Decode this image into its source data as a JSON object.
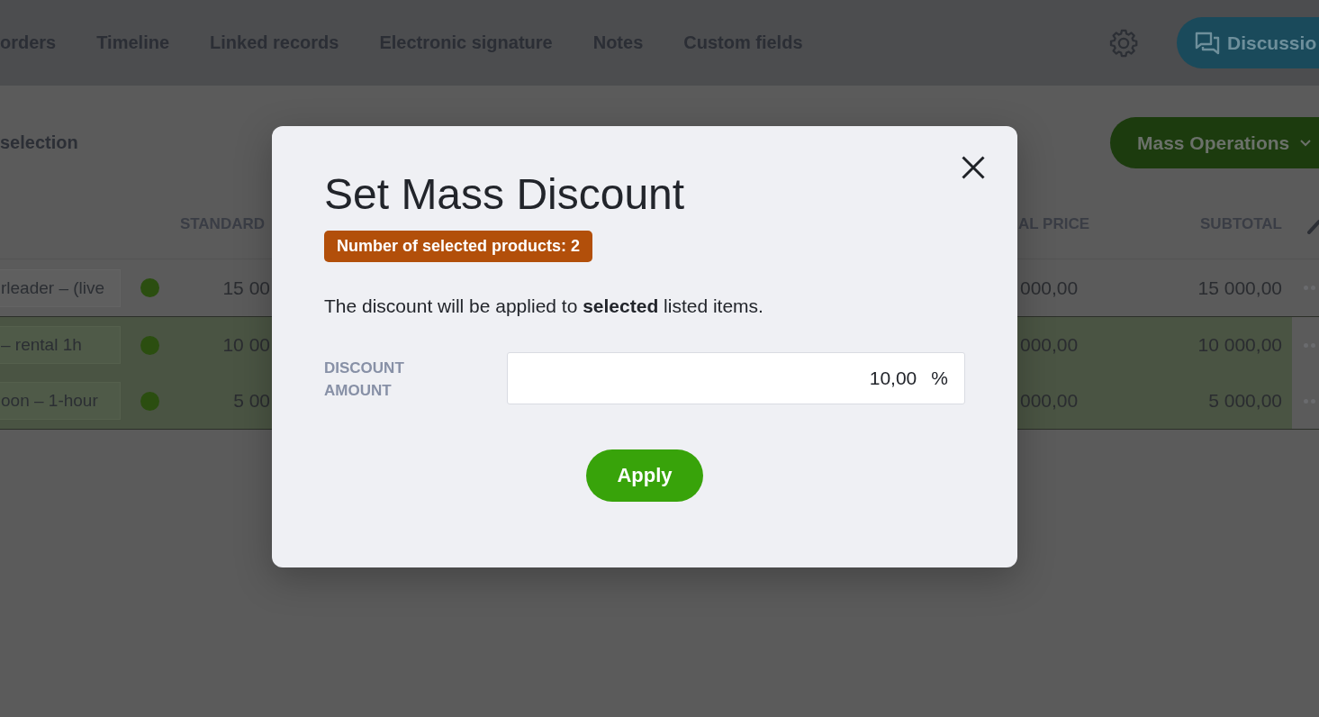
{
  "nav": {
    "tabs": [
      {
        "label": "orders"
      },
      {
        "label": "Timeline"
      },
      {
        "label": "Linked records"
      },
      {
        "label": "Electronic signature"
      },
      {
        "label": "Notes"
      },
      {
        "label": "Custom fields"
      }
    ],
    "discussion_button": "Discussio"
  },
  "toolbar": {
    "selection_label": "selection",
    "mass_operations_button": "Mass Operations"
  },
  "table": {
    "columns": [
      "STANDARD",
      "AL PRICE",
      "SUBTOTAL"
    ],
    "rows": [
      {
        "product": "rleader – (live",
        "standard_price": "15 00",
        "final_price": "000,00",
        "subtotal": "15 000,00",
        "selected": false
      },
      {
        "product": "– rental 1h",
        "standard_price": "10 00",
        "final_price": "000,00",
        "subtotal": "10 000,00",
        "selected": true
      },
      {
        "product": "oon – 1-hour",
        "standard_price": "5 00",
        "final_price": "000,00",
        "subtotal": "5 000,00",
        "selected": true
      }
    ]
  },
  "modal": {
    "title": "Set Mass Discount",
    "badge": "Number of selected products: 2",
    "message": "The discount will be applied to **selected** listed items.",
    "field": {
      "label": "DISCOUNT AMOUNT",
      "value": "10,00",
      "unit": "%"
    },
    "apply_button": "Apply"
  }
}
